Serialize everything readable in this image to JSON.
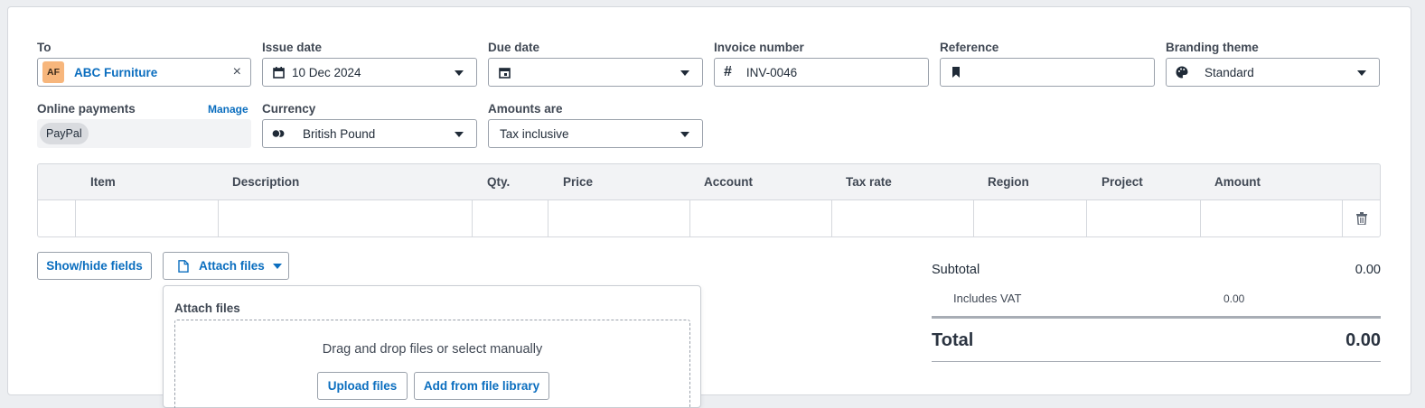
{
  "to": {
    "label": "To",
    "avatar": "AF",
    "value": "ABC Furniture",
    "clear": "×"
  },
  "issue_date": {
    "label": "Issue date",
    "value": "10 Dec 2024"
  },
  "due_date": {
    "label": "Due date",
    "value": ""
  },
  "invoice_number": {
    "label": "Invoice number",
    "prefix": "#",
    "value": "INV-0046"
  },
  "reference": {
    "label": "Reference",
    "value": ""
  },
  "branding": {
    "label": "Branding theme",
    "value": "Standard"
  },
  "online_payments": {
    "label": "Online payments",
    "manage": "Manage",
    "chip": "PayPal"
  },
  "currency": {
    "label": "Currency",
    "value": "British Pound"
  },
  "amounts_are": {
    "label": "Amounts are",
    "value": "Tax inclusive"
  },
  "table": {
    "headers": [
      "Item",
      "Description",
      "Qty.",
      "Price",
      "Account",
      "Tax rate",
      "Region",
      "Project",
      "Amount"
    ]
  },
  "buttons": {
    "show_hide": "Show/hide fields",
    "attach": "Attach files"
  },
  "attach_panel": {
    "title": "Attach files",
    "drop_text": "Drag and drop files or select manually",
    "upload": "Upload files",
    "library": "Add from file library"
  },
  "totals": {
    "subtotal_label": "Subtotal",
    "subtotal_value": "0.00",
    "vat_label": "Includes VAT",
    "vat_value": "0.00",
    "total_label": "Total",
    "total_value": "0.00"
  }
}
